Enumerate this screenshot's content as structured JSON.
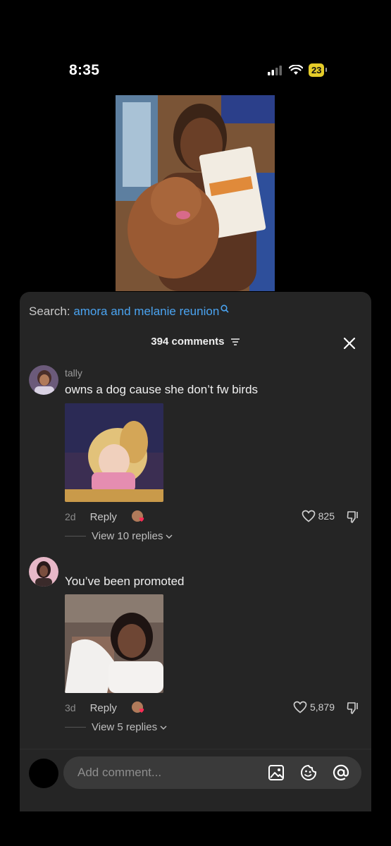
{
  "status_bar": {
    "time": "8:35",
    "battery": "23"
  },
  "search": {
    "label": "Search: ",
    "query": "amora and melanie reunion"
  },
  "comments_header": {
    "count_label": "394 comments"
  },
  "comments": [
    {
      "username": "tally",
      "text": "owns a dog cause she don’t fw birds",
      "age": "2d",
      "reply_label": "Reply",
      "likes": "825",
      "view_replies": "View 10 replies"
    },
    {
      "username": "",
      "text": "You’ve been promoted",
      "age": "3d",
      "reply_label": "Reply",
      "likes": "5,879",
      "view_replies": "View 5 replies"
    }
  ],
  "composer": {
    "placeholder": "Add comment..."
  },
  "colors": {
    "sheet_bg": "#252525",
    "search_query": "#4aa3f0",
    "battery": "#e5cc29"
  }
}
